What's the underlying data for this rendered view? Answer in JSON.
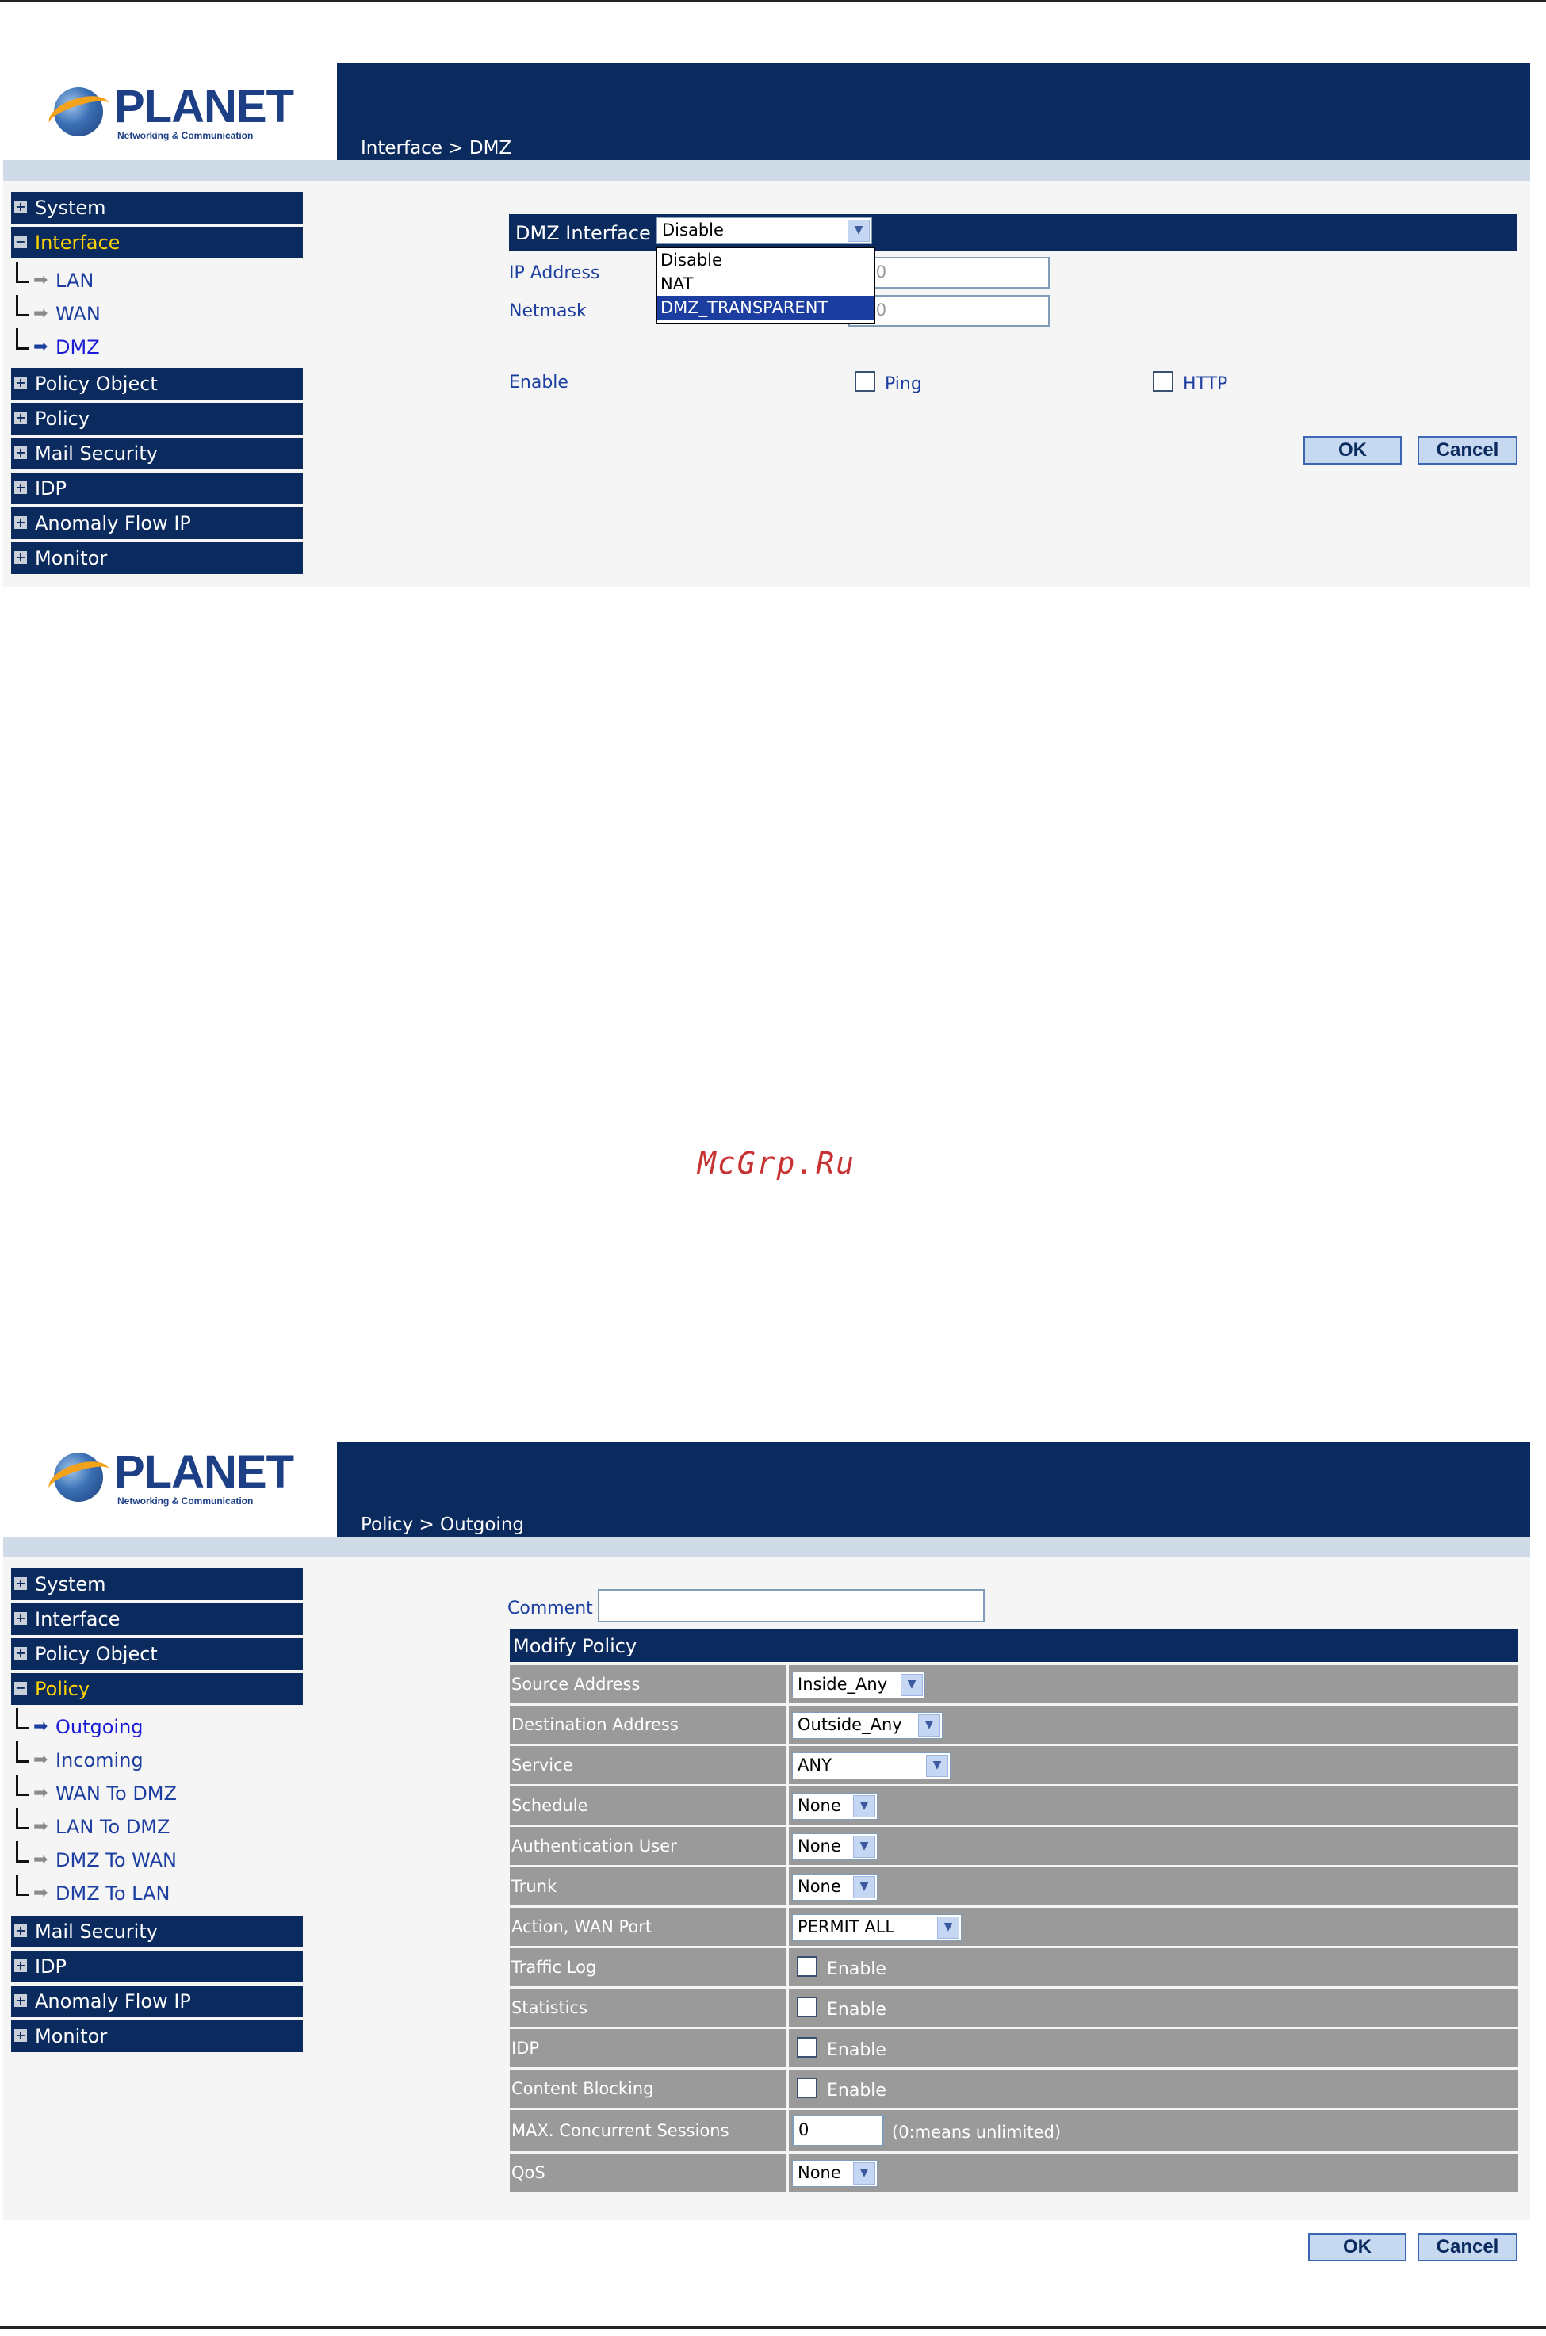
{
  "watermark": "McGrp.Ru",
  "screen1": {
    "logo": {
      "name": "PLANET",
      "tagline": "Networking & Communication"
    },
    "breadcrumb": "Interface > DMZ",
    "sidebar": {
      "items": [
        {
          "label": "System"
        },
        {
          "label": "Interface"
        },
        {
          "label": "Policy Object"
        },
        {
          "label": "Policy"
        },
        {
          "label": "Mail Security"
        },
        {
          "label": "IDP"
        },
        {
          "label": "Anomaly Flow IP"
        },
        {
          "label": "Monitor"
        }
      ],
      "subitems": [
        {
          "label": "LAN"
        },
        {
          "label": "WAN"
        },
        {
          "label": "DMZ"
        }
      ]
    },
    "form": {
      "dmz_interface_label": "DMZ Interface",
      "dmz_interface_value": "Disable",
      "dropdown_options": [
        "Disable",
        "NAT",
        "DMZ_TRANSPARENT"
      ],
      "ip_address_label": "IP Address",
      "ip_address_value": ".0.0",
      "netmask_label": "Netmask",
      "netmask_value": ".0.0",
      "enable_label": "Enable",
      "ping_label": "Ping",
      "http_label": "HTTP",
      "ok_label": "OK",
      "cancel_label": "Cancel"
    }
  },
  "screen2": {
    "logo": {
      "name": "PLANET",
      "tagline": "Networking & Communication"
    },
    "breadcrumb": "Policy > Outgoing",
    "sidebar": {
      "items_top": [
        {
          "label": "System"
        },
        {
          "label": "Interface"
        },
        {
          "label": "Policy Object"
        },
        {
          "label": "Policy"
        }
      ],
      "subitems": [
        {
          "label": "Outgoing"
        },
        {
          "label": "Incoming"
        },
        {
          "label": "WAN To DMZ"
        },
        {
          "label": "LAN To DMZ"
        },
        {
          "label": "DMZ To WAN"
        },
        {
          "label": "DMZ To LAN"
        }
      ],
      "items_bottom": [
        {
          "label": "Mail Security"
        },
        {
          "label": "IDP"
        },
        {
          "label": "Anomaly Flow IP"
        },
        {
          "label": "Monitor"
        }
      ]
    },
    "form": {
      "comment_label": "Comment :",
      "comment_value": "",
      "table_title": "Modify Policy",
      "rows": [
        {
          "label": "Source Address",
          "value": "Inside_Any"
        },
        {
          "label": "Destination Address",
          "value": "Outside_Any"
        },
        {
          "label": "Service",
          "value": "ANY"
        },
        {
          "label": "Schedule",
          "value": "None"
        },
        {
          "label": "Authentication User",
          "value": "None"
        },
        {
          "label": "Trunk",
          "value": "None"
        },
        {
          "label": "Action, WAN Port",
          "value": "PERMIT ALL"
        },
        {
          "label": "Traffic Log",
          "value": "Enable"
        },
        {
          "label": "Statistics",
          "value": "Enable"
        },
        {
          "label": "IDP",
          "value": "Enable"
        },
        {
          "label": "Content Blocking",
          "value": "Enable"
        },
        {
          "label": "MAX. Concurrent Sessions",
          "value": "0",
          "note": "(0:means unlimited)"
        },
        {
          "label": "QoS",
          "value": "None"
        }
      ],
      "ok_label": "OK",
      "cancel_label": "Cancel"
    }
  }
}
